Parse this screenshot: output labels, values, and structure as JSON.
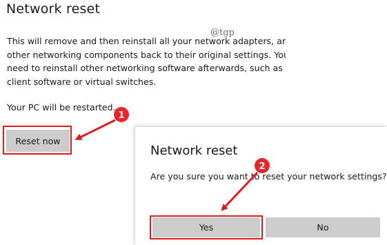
{
  "page": {
    "title": "Network reset",
    "watermark": "@tgp",
    "description_lines": [
      "This will remove and then reinstall all your network adapters, and",
      "other networking components back to their original settings. You",
      "need to reinstall other networking software afterwards, such as VPN",
      "client software or virtual switches."
    ],
    "restart_note": "Your PC will be restarted.",
    "reset_button_label": "Reset now"
  },
  "dialog": {
    "title": "Network reset",
    "message": "Are you sure you want to reset your network settings?",
    "yes_label": "Yes",
    "no_label": "No"
  },
  "annotations": {
    "step1": "1",
    "step2": "2",
    "color": "#e01b1b"
  }
}
